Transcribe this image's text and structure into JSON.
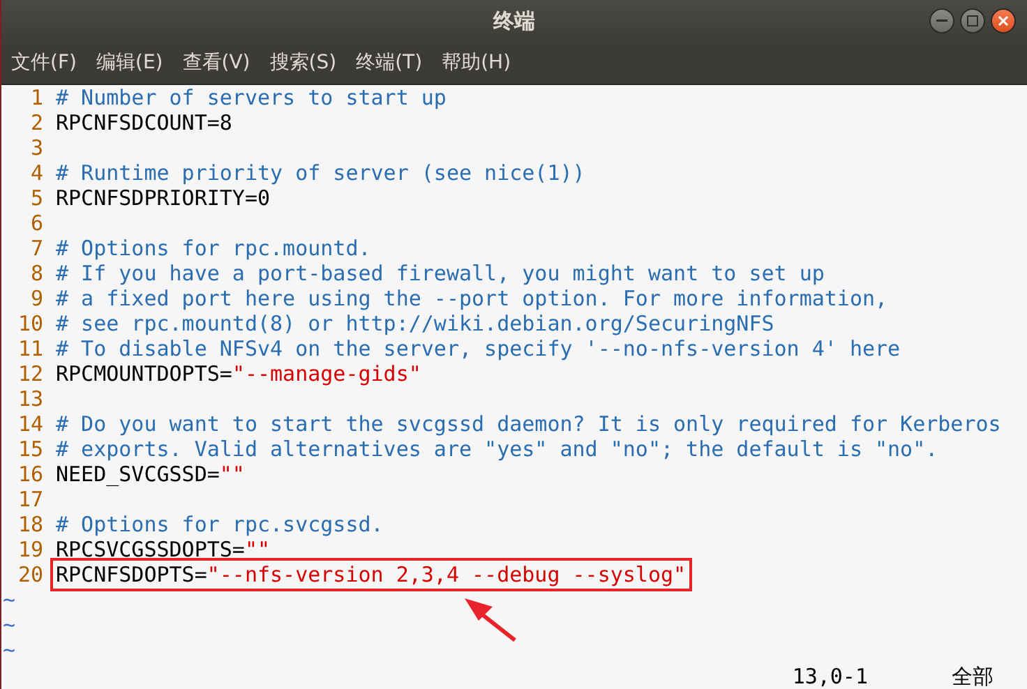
{
  "window": {
    "title": "终端"
  },
  "menu": [
    "文件(F)",
    "编辑(E)",
    "查看(V)",
    "搜索(S)",
    "终端(T)",
    "帮助(H)"
  ],
  "editor": {
    "lines": [
      {
        "number": "1",
        "annotated": false,
        "segments": [
          {
            "kind": "comment",
            "text": "# Number of servers to start up"
          }
        ]
      },
      {
        "number": "2",
        "annotated": false,
        "segments": [
          {
            "kind": "plain",
            "text": "RPCNFSDCOUNT=8"
          }
        ]
      },
      {
        "number": "3",
        "annotated": false
      },
      {
        "number": "4",
        "annotated": false,
        "segments": [
          {
            "kind": "comment",
            "text": "# Runtime priority of server (see nice(1))"
          }
        ]
      },
      {
        "number": "5",
        "annotated": false,
        "segments": [
          {
            "kind": "plain",
            "text": "RPCNFSDPRIORITY=0"
          }
        ]
      },
      {
        "number": "6",
        "annotated": false
      },
      {
        "number": "7",
        "annotated": false,
        "segments": [
          {
            "kind": "comment",
            "text": "# Options for rpc.mountd."
          }
        ]
      },
      {
        "number": "8",
        "annotated": false,
        "segments": [
          {
            "kind": "comment",
            "text": "# If you have a port-based firewall, you might want to set up"
          }
        ]
      },
      {
        "number": "9",
        "annotated": false,
        "segments": [
          {
            "kind": "comment",
            "text": "# a fixed port here using the --port option. For more information,"
          }
        ]
      },
      {
        "number": "10",
        "annotated": false,
        "segments": [
          {
            "kind": "comment",
            "text": "# see rpc.mountd(8) or http://wiki.debian.org/SecuringNFS"
          }
        ]
      },
      {
        "number": "11",
        "annotated": false,
        "segments": [
          {
            "kind": "comment",
            "text": "# To disable NFSv4 on the server, specify '--no-nfs-version 4' here"
          }
        ]
      },
      {
        "number": "12",
        "annotated": false,
        "segments": [
          {
            "kind": "plain",
            "text": "RPCMOUNTDOPTS="
          },
          {
            "kind": "string",
            "text": "\"--manage-gids\""
          }
        ]
      },
      {
        "number": "13",
        "annotated": false
      },
      {
        "number": "14",
        "annotated": false,
        "segments": [
          {
            "kind": "comment",
            "text": "# Do you want to start the svcgssd daemon? It is only required for Kerberos"
          }
        ]
      },
      {
        "number": "15",
        "annotated": false,
        "segments": [
          {
            "kind": "comment",
            "text": "# exports. Valid alternatives are \"yes\" and \"no\"; the default is \"no\"."
          }
        ]
      },
      {
        "number": "16",
        "annotated": false,
        "segments": [
          {
            "kind": "plain",
            "text": "NEED_SVCGSSD="
          },
          {
            "kind": "string",
            "text": "\"\""
          }
        ]
      },
      {
        "number": "17",
        "annotated": false
      },
      {
        "number": "18",
        "annotated": false,
        "segments": [
          {
            "kind": "comment",
            "text": "# Options for rpc.svcgssd."
          }
        ]
      },
      {
        "number": "19",
        "annotated": false,
        "segments": [
          {
            "kind": "plain",
            "text": "RPCSVCGSSDOPTS="
          },
          {
            "kind": "string",
            "text": "\"\""
          }
        ]
      },
      {
        "number": "20",
        "annotated": true,
        "segments": [
          {
            "kind": "plain",
            "text": "RPCNFSDOPTS="
          },
          {
            "kind": "string",
            "text": "\"--nfs-version 2,3,4 --debug --syslog\""
          }
        ]
      }
    ],
    "tildes": [
      "~",
      "~",
      "~"
    ],
    "status": {
      "position": "13,0-1",
      "scroll": "全部"
    }
  }
}
